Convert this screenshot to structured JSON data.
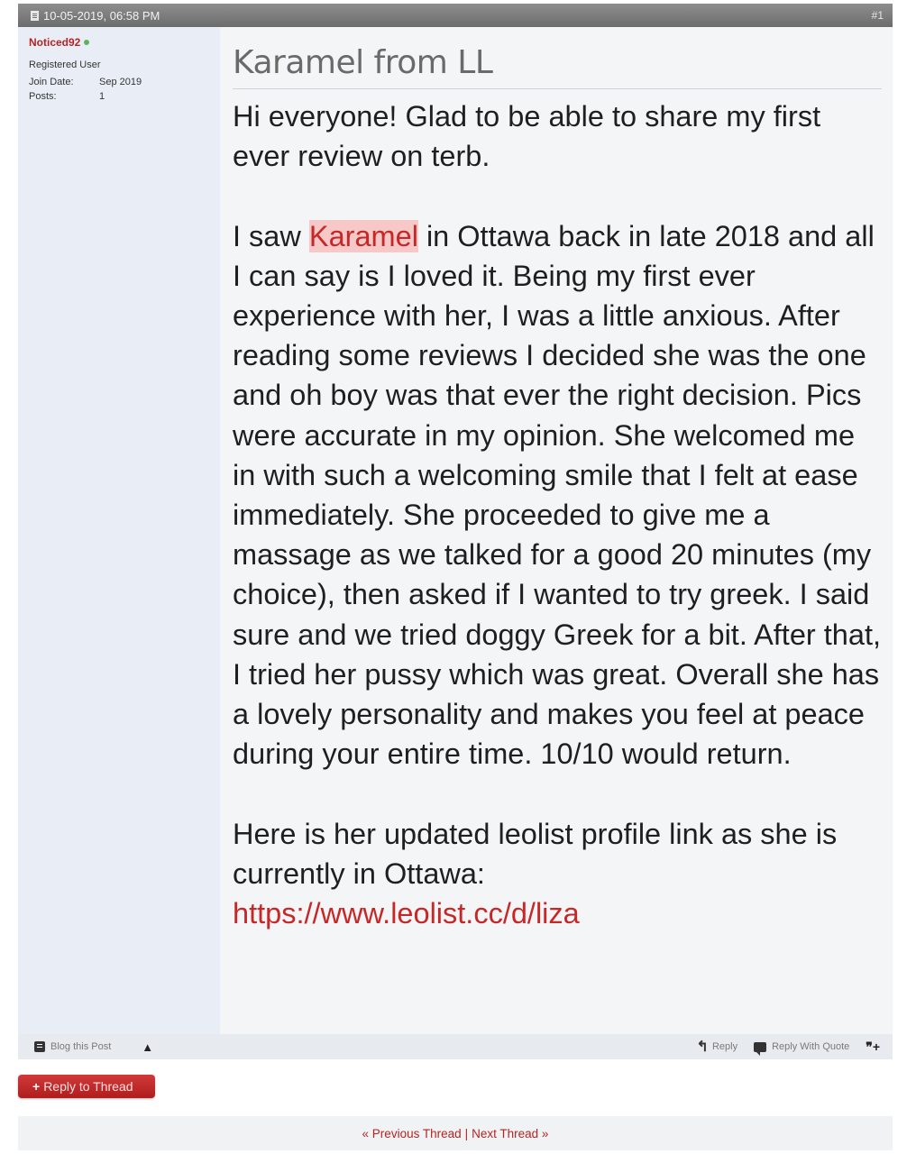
{
  "post": {
    "date": "10-05-2019, 06:58 PM",
    "number": "#1",
    "title": "Karamel from LL",
    "body": {
      "intro": "Hi everyone! Glad to be able to share my first ever review on terb.",
      "p2_before": "I saw ",
      "p2_highlight": "Karamel",
      "p2_after": " in Ottawa back in late 2018 and all I can say is I loved it. Being my first ever experience with her, I was a little anxious. After reading some reviews I decided she was the one and oh boy was that ever the right decision. Pics were accurate in my opinion. She welcomed me in with such a welcoming smile that I felt at ease immediately. She proceeded to give me a massage as we talked for a good 20 minutes (my choice), then asked if I wanted to try greek. I said sure and we tried doggy Greek for a bit. After that, I tried her pussy which was great. Overall she has a lovely personality and makes you feel at peace during your entire time. 10/10 would return.",
      "p3": "Here is her updated leolist profile link as she is currently in Ottawa:",
      "link": "https://www.leolist.cc/d/liza"
    }
  },
  "user": {
    "name": "Noticed92",
    "title": "Registered User",
    "join_label": "Join Date:",
    "join_value": "Sep 2019",
    "posts_label": "Posts:",
    "posts_value": "1"
  },
  "footer": {
    "blog_label": "Blog this Post",
    "reply_label": "Reply",
    "quote_label": "Reply With Quote"
  },
  "actions": {
    "reply_thread": "Reply to Thread"
  },
  "nav": {
    "prev": "« Previous Thread",
    "sep": "|",
    "next": "Next Thread »"
  },
  "colors": {
    "accent": "#b52424",
    "header_bar": "#7a7a7a",
    "sidebar": "#e9eef6"
  }
}
